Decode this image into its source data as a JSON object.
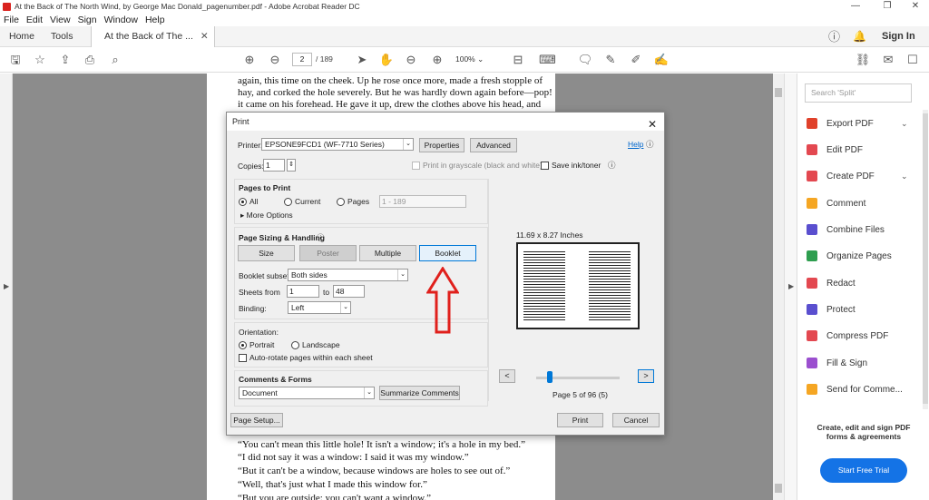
{
  "window": {
    "title": "At the Back of The North Wind, by George Mac Donald_pagenumber.pdf - Adobe Acrobat Reader DC",
    "minimize": "—",
    "maximize": "❐",
    "close": "✕"
  },
  "menu": [
    "File",
    "Edit",
    "View",
    "Sign",
    "Window",
    "Help"
  ],
  "tabs": {
    "home": "Home",
    "tools": "Tools",
    "document": "At the Back of The ...",
    "sign_in": "Sign In"
  },
  "toolbar": {
    "current_page": "2",
    "total_pages": "/ 189",
    "zoom": "100%"
  },
  "document_text": {
    "top": [
      "again, this time on the cheek. Up he rose once more, made a fresh stopple of",
      "hay, and corked the hole severely. But he was hardly down again before—pop!",
      "it came on his forehead. He gave it up, drew the clothes above his head, and"
    ],
    "bottom": [
      "“You can't mean this little hole! It isn't a window; it's a hole in my bed.”",
      "“I did not say it was a window: I said it was my window.”",
      "“But it can't be a window, because windows are holes to see out of.”",
      "“Well, that's just what I made this window for.”",
      "“But you are outside: you can't want a window.”"
    ]
  },
  "right_panel": {
    "search_placeholder": "Search 'Split'",
    "items": [
      {
        "label": "Export PDF",
        "color": "#e0412b",
        "has_chevron": true
      },
      {
        "label": "Edit PDF",
        "color": "#e34850",
        "has_chevron": false
      },
      {
        "label": "Create PDF",
        "color": "#e34850",
        "has_chevron": true
      },
      {
        "label": "Comment",
        "color": "#f5a623",
        "has_chevron": false
      },
      {
        "label": "Combine Files",
        "color": "#5a4fcf",
        "has_chevron": false
      },
      {
        "label": "Organize Pages",
        "color": "#2e9e4f",
        "has_chevron": false
      },
      {
        "label": "Redact",
        "color": "#e34850",
        "has_chevron": false
      },
      {
        "label": "Protect",
        "color": "#5a4fcf",
        "has_chevron": false
      },
      {
        "label": "Compress PDF",
        "color": "#e34850",
        "has_chevron": false
      },
      {
        "label": "Fill & Sign",
        "color": "#9b4fcf",
        "has_chevron": false
      },
      {
        "label": "Send for Comme...",
        "color": "#f5a623",
        "has_chevron": false
      }
    ],
    "promo_line1": "Create, edit and sign PDF",
    "promo_line2": "forms & agreements",
    "trial_button": "Start Free Trial",
    "chevron": "⌄"
  },
  "print_dialog": {
    "title": "Print",
    "close": "✕",
    "printer_label": "Printer:",
    "printer_value": "EPSONE9FCD1 (WF-7710 Series)",
    "properties": "Properties",
    "advanced": "Advanced",
    "help": "Help",
    "copies_label": "Copies:",
    "copies_value": "1",
    "grayscale": "Print in grayscale (black and white)",
    "save_ink": "Save ink/toner",
    "pages_to_print": "Pages to Print",
    "all": "All",
    "current": "Current",
    "pages": "Pages",
    "pages_range": "1 - 189",
    "more_options": "More Options",
    "page_sizing": "Page Sizing & Handling",
    "size": "Size",
    "poster": "Poster",
    "multiple": "Multiple",
    "booklet": "Booklet",
    "booklet_subset_label": "Booklet subset:",
    "booklet_subset_value": "Both sides",
    "sheets_from_label": "Sheets from",
    "sheets_from_value": "1",
    "to_label": "to",
    "sheets_to_value": "48",
    "binding_label": "Binding:",
    "binding_value": "Left",
    "orientation": "Orientation:",
    "portrait": "Portrait",
    "landscape": "Landscape",
    "auto_rotate": "Auto-rotate pages within each sheet",
    "comments_forms": "Comments & Forms",
    "comments_value": "Document",
    "summarize": "Summarize Comments",
    "page_setup": "Page Setup...",
    "print": "Print",
    "cancel": "Cancel",
    "paper_size": "11.69 x 8.27 Inches",
    "page_indicator": "Page 5 of 96 (5)",
    "prev": "<",
    "next": ">",
    "dropdown_arrow": "⌄",
    "info_icon": "ⓘ",
    "more_options_arrow": "▸",
    "spinner": "⇕"
  }
}
